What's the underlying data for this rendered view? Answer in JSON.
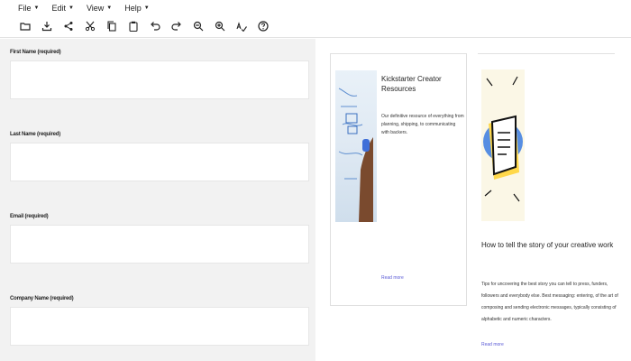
{
  "menu": {
    "items": [
      {
        "label": "File"
      },
      {
        "label": "Edit"
      },
      {
        "label": "View"
      },
      {
        "label": "Help"
      }
    ]
  },
  "toolbar": {
    "icons": [
      "open-folder-icon",
      "download-icon",
      "share-icon",
      "cut-icon",
      "copy-icon",
      "paste-icon",
      "undo-icon",
      "redo-icon",
      "zoom-out-icon",
      "zoom-in-icon",
      "spell-check-icon",
      "help-icon"
    ]
  },
  "form": {
    "fields": [
      {
        "label": "First Name (required)",
        "value": ""
      },
      {
        "label": "Last Name (required)",
        "value": ""
      },
      {
        "label": "Email (required)",
        "value": ""
      },
      {
        "label": "Company Name (required)",
        "value": ""
      }
    ]
  },
  "card": {
    "title": "Kickstarter Creator Resources",
    "description": "Our definitive resource of everything from planning, shipping, to communicating with backers.",
    "link": "Read more"
  },
  "article": {
    "title": "How to tell the story of your creative work",
    "body": "Tips for uncovering the best story you can tell to press, funders, followers and everybody else. Best messaging: entering, of the art of composing and sending electronic messages, typically consisting of alphabetic and numeric characters.",
    "link": "Read more"
  }
}
